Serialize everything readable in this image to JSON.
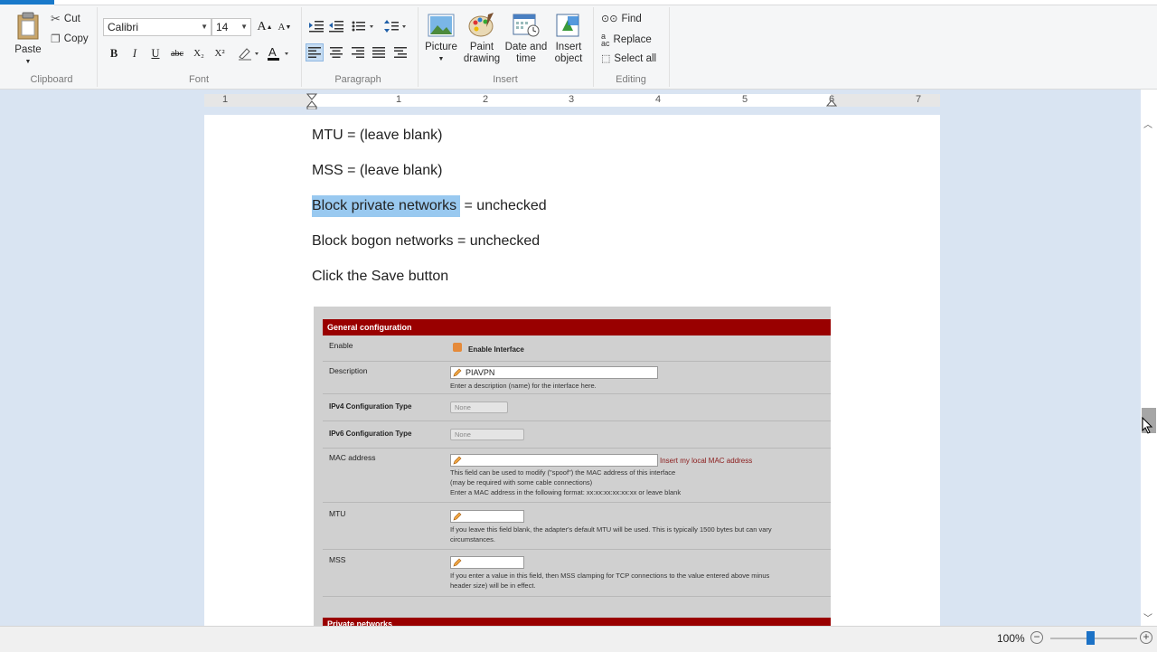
{
  "ribbon": {
    "clipboard": {
      "paste": "Paste",
      "cut": "Cut",
      "copy": "Copy",
      "group": "Clipboard"
    },
    "font": {
      "family": "Calibri",
      "size": "14",
      "group": "Font",
      "bold": "B",
      "italic": "I",
      "underline": "U",
      "strike": "abc",
      "subscript": "X₂",
      "superscript": "X²"
    },
    "paragraph": {
      "group": "Paragraph"
    },
    "insert": {
      "picture": "Picture",
      "paint_line1": "Paint",
      "paint_line2": "drawing",
      "datetime_line1": "Date and",
      "datetime_line2": "time",
      "object_line1": "Insert",
      "object_line2": "object",
      "group": "Insert"
    },
    "editing": {
      "find": "Find",
      "replace": "Replace",
      "select_all": "Select all",
      "group": "Editing"
    }
  },
  "ruler": {
    "numbers": [
      "1",
      "1",
      "2",
      "3",
      "4",
      "5",
      "6",
      "7"
    ]
  },
  "document": {
    "line1": "MTU = (leave blank)",
    "line2": "MSS = (leave blank)",
    "line3_selected": "Block private networks",
    "line3_rest": " = unchecked",
    "line4": "Block bogon networks = unchecked",
    "line5": "Click the Save button"
  },
  "screenshot": {
    "header": "General configuration",
    "enable_label": "Enable",
    "enable_checkbox": "Enable Interface",
    "description_label": "Description",
    "description_value": "PIAVPN",
    "description_help": "Enter a description (name) for the interface here.",
    "ipv4_label": "IPv4 Configuration Type",
    "ipv4_value": "None",
    "ipv6_label": "IPv6 Configuration Type",
    "ipv6_value": "None",
    "mac_label": "MAC address",
    "mac_link": "Insert my local MAC address",
    "mac_help1": "This field can be used to modify (\"spoof\") the MAC address of this interface",
    "mac_help2": "(may be required with some cable connections)",
    "mac_help3": "Enter a MAC address in the following format: xx:xx:xx:xx:xx:xx or leave blank",
    "mtu_label": "MTU",
    "mtu_help1": "If you leave this field blank, the adapter's default MTU will be used. This is typically 1500 bytes but can vary",
    "mtu_help2": "circumstances.",
    "mss_label": "MSS",
    "mss_help1": "If you enter a value in this field, then MSS clamping for TCP connections to the value entered above minus",
    "mss_help2": "header size) will be in effect.",
    "header2": "Private networks"
  },
  "status": {
    "zoom": "100%",
    "zoom_minus": "−",
    "zoom_plus": "+"
  },
  "colors": {
    "selection": "#99c9f0",
    "pfsense_header": "#990000",
    "accent": "#1979ca"
  }
}
